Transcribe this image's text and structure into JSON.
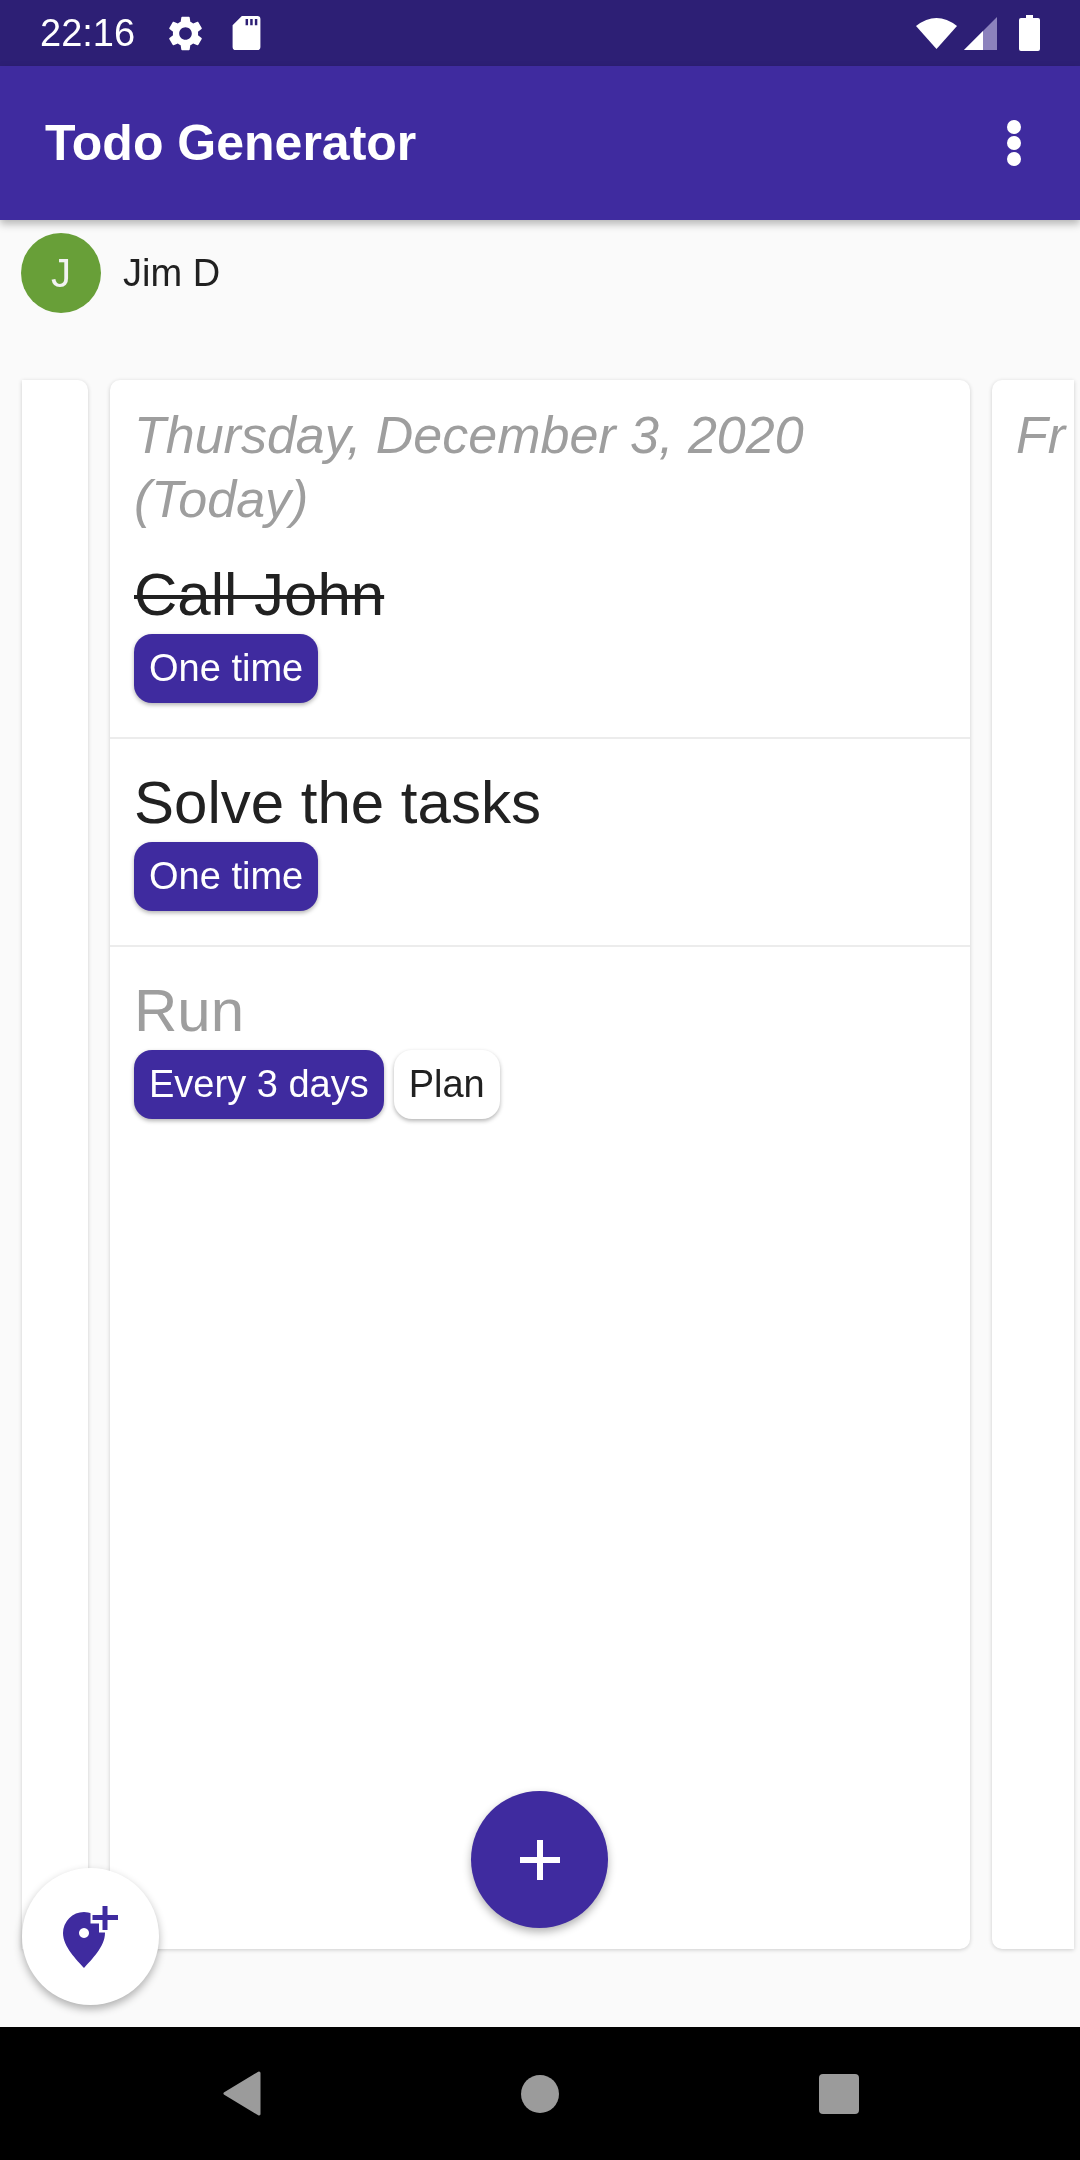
{
  "status_bar": {
    "time": "22:16"
  },
  "app_bar": {
    "title": "Todo Generator"
  },
  "user": {
    "avatar_initial": "J",
    "name": "Jim D"
  },
  "previous_day_peek": true,
  "days": [
    {
      "heading": "Thursday, December 3, 2020 (Today)",
      "todos": [
        {
          "title": "Call John",
          "done": true,
          "disabled": false,
          "tags": [
            {
              "label": "One time",
              "kind": "recurrence"
            }
          ]
        },
        {
          "title": "Solve the tasks",
          "done": false,
          "disabled": false,
          "tags": [
            {
              "label": "One time",
              "kind": "recurrence"
            }
          ]
        },
        {
          "title": "Run",
          "done": false,
          "disabled": true,
          "tags": [
            {
              "label": "Every 3 days",
              "kind": "recurrence"
            },
            {
              "label": "Plan",
              "kind": "action"
            }
          ]
        }
      ]
    },
    {
      "heading": "Fr"
    }
  ]
}
